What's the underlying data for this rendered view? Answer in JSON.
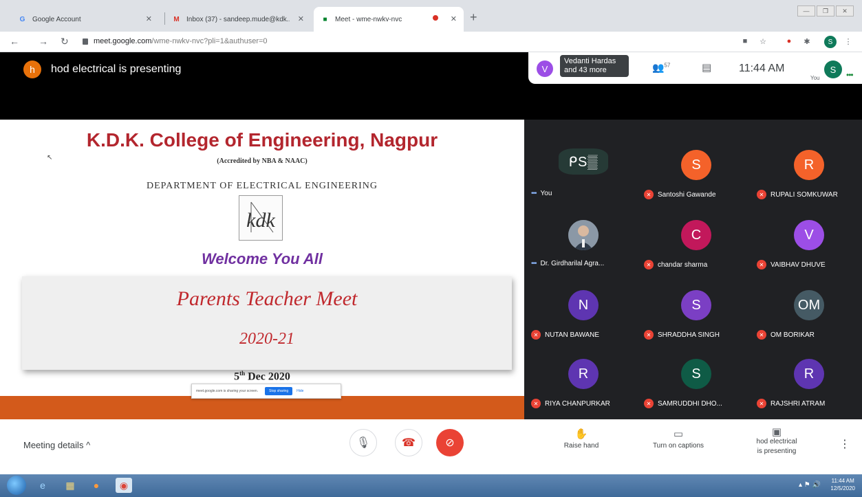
{
  "browser": {
    "tabs": [
      {
        "title": "Google Account",
        "icon": "google-g-icon"
      },
      {
        "title": "Inbox (37) - sandeep.mude@kdk...",
        "icon": "gmail-icon"
      },
      {
        "title": "Meet - wme-nwkv-nvc",
        "icon": "meet-icon"
      }
    ],
    "url_host": "meet.google.com",
    "url_path": "/wme-nwkv-nvc?pli=1&authuser=0",
    "profile_initial": "S"
  },
  "meet": {
    "presenter_initial": "h",
    "presenter_text": "hod electrical is presenting",
    "participants_summary_initial": "V",
    "participants_summary": "Vedanti Hardas and 43 more",
    "people_count": "57",
    "time": "11:44 AM",
    "you_label": "You",
    "self_initial": "S"
  },
  "slide": {
    "title": "K.D.K. College of Engineering, Nagpur",
    "accreditation": "(Accredited by NBA & NAAC)",
    "department": "DEPARTMENT OF ELECTRICAL ENGINEERING",
    "logo_text": "kdk",
    "welcome": "Welcome You All",
    "event": "Parents Teacher Meet",
    "year": "2020-21",
    "date_day": "5",
    "date_suffix": "th",
    "date_rest": "Dec 2020",
    "share_notice": "meet.google.com is sharing your screen.",
    "stop_sharing": "Stop sharing",
    "hide": "Hide"
  },
  "participants": [
    {
      "name": "You",
      "initial": "",
      "color": "#263a36",
      "muted": false,
      "you": true
    },
    {
      "name": "Santoshi Gawande",
      "initial": "S",
      "color": "#f4622a",
      "muted": true
    },
    {
      "name": "RUPALI SOMKUWAR",
      "initial": "R",
      "color": "#f4622a",
      "muted": true
    },
    {
      "name": "Dr. Girdharilal Agra...",
      "initial": "",
      "color": "#6b7886",
      "muted": false,
      "photo": true
    },
    {
      "name": "chandar sharma",
      "initial": "C",
      "color": "#c2185b",
      "muted": true
    },
    {
      "name": "VAIBHAV DHUVE",
      "initial": "V",
      "color": "#9c4ee6",
      "muted": true
    },
    {
      "name": "NUTAN BAWANE",
      "initial": "N",
      "color": "#5e35b1",
      "muted": true
    },
    {
      "name": "SHRADDHA SINGH",
      "initial": "S",
      "color": "#7b3fc4",
      "muted": true
    },
    {
      "name": "OM BORIKAR",
      "initial": "OM",
      "color": "#455a64",
      "muted": true
    },
    {
      "name": "RIYA CHANPURKAR",
      "initial": "R",
      "color": "#5e35b1",
      "muted": true
    },
    {
      "name": "SAMRUDDHI DHO...",
      "initial": "S",
      "color": "#0f5b46",
      "muted": true
    },
    {
      "name": "RAJSHRI ATRAM",
      "initial": "R",
      "color": "#5e35b1",
      "muted": true
    }
  ],
  "controls": {
    "meeting_details": "Meeting details",
    "raise_hand": "Raise hand",
    "captions": "Turn on captions",
    "presenting_line1": "hod electrical",
    "presenting_line2": "is presenting"
  },
  "taskbar": {
    "clock_time": "11:44 AM",
    "clock_date": "12/5/2020"
  }
}
